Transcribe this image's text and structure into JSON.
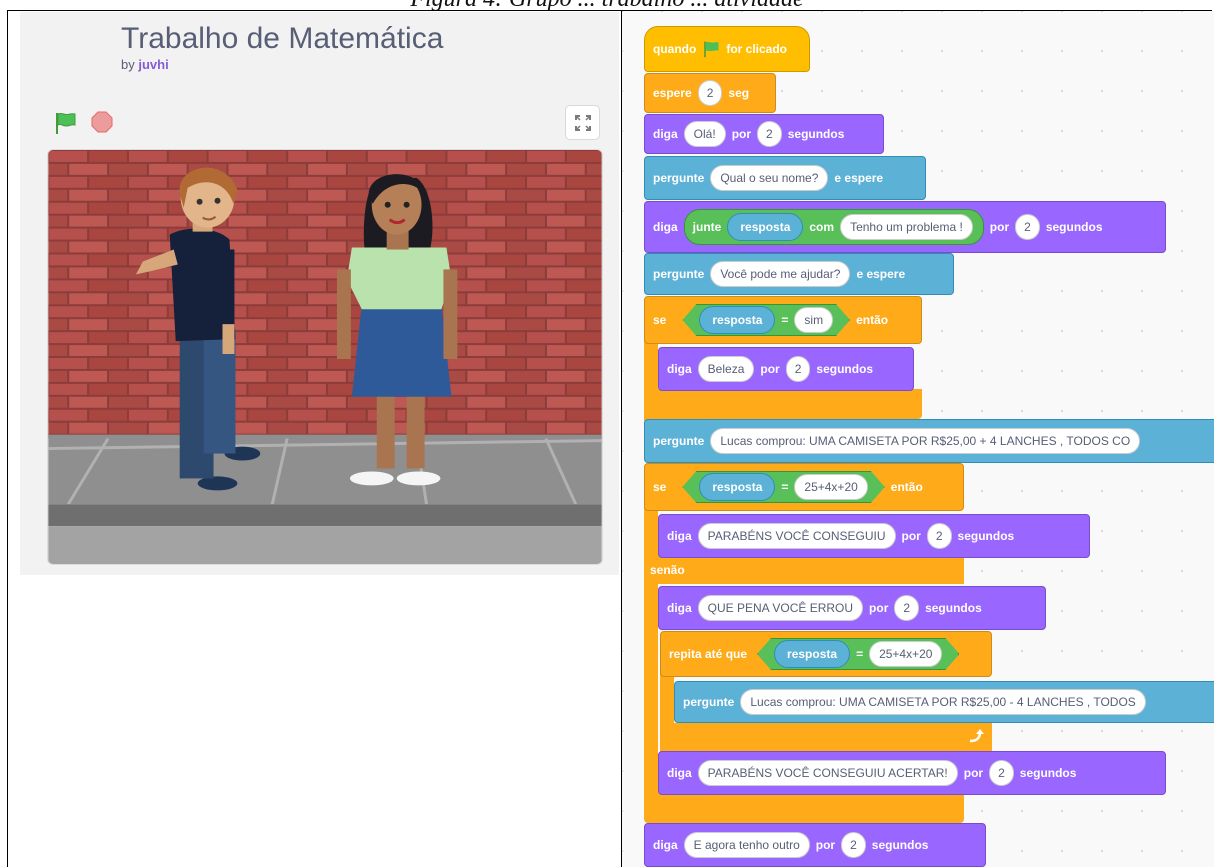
{
  "caption": "Figura 4: Grupo ... trabalho ... atividade",
  "project": {
    "title": "Trabalho de Matemática",
    "by_label": "by",
    "author": "juvhi"
  },
  "icons": {
    "flag": "green-flag-icon",
    "stop": "stop-icon",
    "fullscreen": "fullscreen-icon",
    "rotate": "loop-arrow-icon"
  },
  "colors": {
    "events": "#ffbf00",
    "control": "#ffab19",
    "looks": "#9966ff",
    "sensing": "#5cb1d6",
    "operators": "#59c059"
  },
  "blocks": {
    "b1": {
      "a": "quando",
      "b": "for clicado"
    },
    "b2": {
      "a": "espere",
      "v": "2",
      "b": "seg"
    },
    "b3": {
      "a": "diga",
      "t": "Olá!",
      "b": "por",
      "v": "2",
      "c": "segundos"
    },
    "b4": {
      "a": "pergunte",
      "t": "Qual o seu nome?",
      "b": "e espere"
    },
    "b5": {
      "a": "diga",
      "j": "junte",
      "r": "resposta",
      "com": "com",
      "t": "Tenho um problema !",
      "b": "por",
      "v": "2",
      "c": "segundos"
    },
    "b6": {
      "a": "pergunte",
      "t": "Você pode me ajudar?",
      "b": "e espere"
    },
    "b7": {
      "a": "se",
      "r": "resposta",
      "eq": "=",
      "t": "sim",
      "b": "então"
    },
    "b8": {
      "a": "diga",
      "t": "Beleza",
      "b": "por",
      "v": "2",
      "c": "segundos"
    },
    "b9": {
      "a": "pergunte",
      "t": "Lucas comprou: UMA CAMISETA POR R$25,00 + 4 LANCHES , TODOS CO"
    },
    "b10": {
      "a": "se",
      "r": "resposta",
      "eq": "=",
      "t": "25+4x+20",
      "b": "então"
    },
    "b11": {
      "a": "diga",
      "t": "PARABÉNS VOCÊ CONSEGUIU",
      "b": "por",
      "v": "2",
      "c": "segundos"
    },
    "b12": {
      "a": "senão"
    },
    "b13": {
      "a": "diga",
      "t": "QUE PENA VOCÊ ERROU",
      "b": "por",
      "v": "2",
      "c": "segundos"
    },
    "b14": {
      "a": "repita até que",
      "r": "resposta",
      "eq": "=",
      "t": "25+4x+20"
    },
    "b15": {
      "a": "pergunte",
      "t": "Lucas comprou: UMA CAMISETA POR R$25,00 - 4 LANCHES , TODOS"
    },
    "b16": {
      "a": "diga",
      "t": "PARABÉNS VOCÊ CONSEGUIU ACERTAR!",
      "b": "por",
      "v": "2",
      "c": "segundos"
    },
    "b17": {
      "a": "diga",
      "t": "E agora tenho outro",
      "b": "por",
      "v": "2",
      "c": "segundos"
    }
  }
}
